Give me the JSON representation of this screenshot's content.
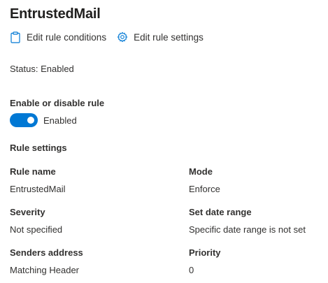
{
  "header": {
    "title": "EntrustedMail",
    "actions": [
      {
        "label": "Edit rule conditions",
        "icon": "clipboard-icon"
      },
      {
        "label": "Edit rule settings",
        "icon": "gear-icon"
      }
    ]
  },
  "status_text": "Status: Enabled",
  "toggle_section": {
    "heading": "Enable or disable rule",
    "state": "on",
    "state_label": "Enabled",
    "accent_color": "#0078d4"
  },
  "rule_settings": {
    "heading": "Rule settings",
    "fields": [
      {
        "label": "Rule name",
        "value": "EntrustedMail"
      },
      {
        "label": "Mode",
        "value": "Enforce"
      },
      {
        "label": "Severity",
        "value": "Not specified"
      },
      {
        "label": "Set date range",
        "value": "Specific date range is not set"
      },
      {
        "label": "Senders address",
        "value": "Matching Header"
      },
      {
        "label": "Priority",
        "value": "0"
      }
    ]
  }
}
